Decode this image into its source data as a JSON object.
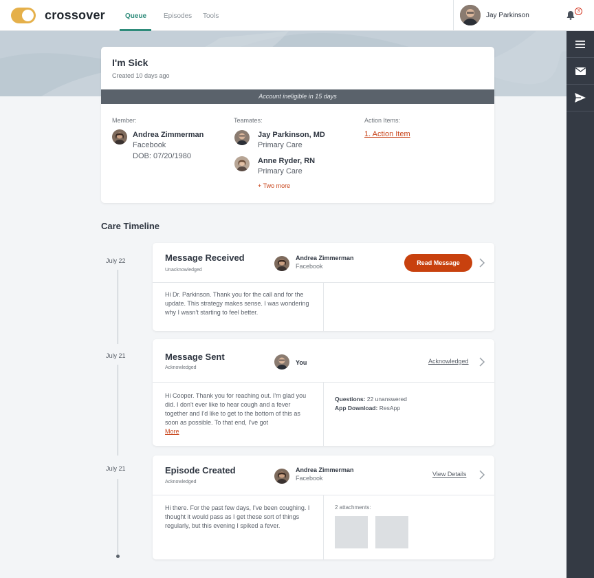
{
  "app": {
    "brand": "crossover"
  },
  "nav": {
    "tabs": [
      {
        "label": "Queue"
      },
      {
        "label": "Episodes"
      },
      {
        "label": "Tools"
      }
    ]
  },
  "user": {
    "name": "Jay Parkinson",
    "notification_count": "3"
  },
  "episode": {
    "title": "I'm Sick",
    "created": "Created 10 days ago",
    "banner": "Account ineligible in 15 days",
    "member_label": "Member:",
    "member": {
      "name": "Andrea Zimmerman",
      "org": "Facebook",
      "dob": "DOB: 07/20/1980"
    },
    "teamates_label": "Teamates:",
    "teamates": [
      {
        "name": "Jay Parkinson, MD",
        "role": "Primary Care"
      },
      {
        "name": "Anne Ryder, RN",
        "role": "Primary Care"
      }
    ],
    "two_more": "+ Two more",
    "action_items_label": "Action Items:",
    "action_item": "1. Action Item"
  },
  "timeline": {
    "title": "Care Timeline",
    "items": [
      {
        "date": "July 22",
        "title": "Message Received",
        "status": "Unacknowledged",
        "person": "Andrea Zimmerman",
        "person_sub": "Facebook",
        "action": "Read Message",
        "body": "Hi Dr. Parkinson. Thank you for the call and for the update. This strategy makes sense. I was wondering why I wasn't starting to feel better."
      },
      {
        "date": "July 21",
        "title": "Message Sent",
        "status": "Acknowledged",
        "person": "You",
        "action": "Acknowledged",
        "body": "Hi Cooper. Thank you for reaching out. I'm glad you did. I don't ever like to hear cough and a fever together and I'd like to get to the bottom of this as soon as possible. To that end, I've got",
        "more": "More",
        "questions_label": "Questions:",
        "questions_value": "22 unanswered",
        "download_label": "App Download:",
        "download_value": "ResApp"
      },
      {
        "date": "July 21",
        "title": "Episode Created",
        "status": "Acknowledged",
        "person": "Andrea Zimmerman",
        "person_sub": "Facebook",
        "action": "View Details",
        "body": "Hi there. For the past few days, I've been coughing. I thought it would pass as I get these sort of things regularly, but this evening I spiked a fever.",
        "attachments_label": "2 attachments:"
      }
    ]
  },
  "colors": {
    "accent": "#c8410e",
    "brand_toggle": "#e5b04a",
    "nav_active": "#2e8b7a",
    "sidebar": "#343a44"
  },
  "icons": [
    "hamburger-icon",
    "mail-icon",
    "send-icon",
    "bell-icon",
    "chevron-right-icon"
  ]
}
